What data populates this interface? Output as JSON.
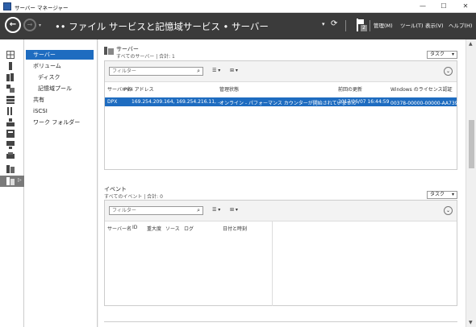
{
  "window": {
    "title": "サーバー マネージャー",
    "minimize": "—",
    "maximize": "☐",
    "close": "✕"
  },
  "nav": {
    "breadcrumb": "•• ファイル サービスと記憶域サービス • サーバー",
    "dropdown": "▾",
    "refresh": "⟳",
    "flag_count": "2",
    "menu_manage": "管理(M)",
    "menu_tools": "ツール(T)",
    "menu_view": "表示(V)",
    "menu_help": "ヘルプ(H)"
  },
  "left_nav": {
    "items": [
      {
        "label": "サーバー",
        "selected": true
      },
      {
        "label": "ボリューム"
      },
      {
        "label": "ディスク",
        "sub": true
      },
      {
        "label": "記憶域プール",
        "sub": true
      },
      {
        "label": "共有"
      },
      {
        "label": "iSCSI"
      },
      {
        "label": "ワーク フォルダー"
      }
    ],
    "rail_arrow": "▷"
  },
  "servers": {
    "title": "サーバー",
    "subtitle": "すべてのサーバー | 合計: 1",
    "tasks_label": "タスク",
    "filter_placeholder": "フィルター",
    "toolbar_btn1": "☰ ▾",
    "toolbar_btn2": "⊞ ▾",
    "headers": [
      "サーバー名",
      "IPv4 アドレス",
      "管理状態",
      "前回の更新",
      "Windows のライセンス認証"
    ],
    "rows": [
      [
        "DPX",
        "169.254.209.164, 169.254.216.11, ...",
        "オンライン - パフォーマンス カウンターが開始されていません",
        "2017/06/07 16:44:59",
        "00378-00000-00000-AA739 (ライ"
      ]
    ]
  },
  "events": {
    "title": "イベント",
    "subtitle": "すべてのイベント | 合計: 0",
    "tasks_label": "タスク",
    "filter_placeholder": "フィルター",
    "toolbar_btn1": "☰ ▾",
    "toolbar_btn2": "⊞ ▾",
    "headers": [
      "サーバー名",
      "ID",
      "重大度",
      "ソース",
      "ログ",
      "日付と時刻"
    ]
  },
  "colors": {
    "accent": "#1e6cc0",
    "navbar": "#3b3b3b"
  }
}
